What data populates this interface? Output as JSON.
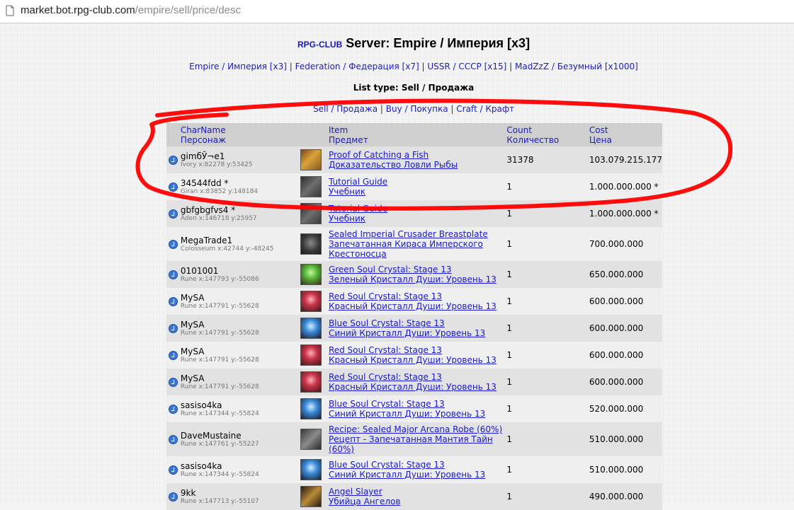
{
  "browser": {
    "url_host": "market.bot.rpg-club.com",
    "url_path": "/empire/sell/price/desc"
  },
  "header": {
    "brand": "RPG-CLUB",
    "title": "Server: Empire / Империя [x3]",
    "servers": [
      "Empire / Империя [x3]",
      "Federation / Федерация [x7]",
      "USSR / СССР [x15]",
      "MadZzZ / Безумный [x1000]"
    ],
    "separator": "|",
    "list_type": "List type: Sell / Продажа",
    "types": [
      "Sell / Продажа",
      "Buy / Покупка",
      "Craft / Крафт"
    ]
  },
  "table": {
    "columns": {
      "char": [
        "CharName",
        "Персонаж"
      ],
      "item": [
        "Item",
        "Предмет"
      ],
      "count": [
        "Count",
        "Количество"
      ],
      "cost": [
        "Cost",
        "Цена"
      ]
    },
    "rows": [
      {
        "char": "gimбЎ¬e1",
        "loc": "Ivory x:82278 y:53425",
        "icon": "fish-proof-icon",
        "item_en": "Proof of Catching a Fish",
        "item_ru": "Доказательство Ловли Рыбы",
        "count": "31378",
        "cost": "103.079.215.177"
      },
      {
        "char": "34544fdd *",
        "loc": "Giran x:83852 y:148184",
        "icon": "book-icon",
        "item_en": "Tutorial Guide",
        "item_ru": "Учебник",
        "count": "1",
        "cost": "1.000.000.000 *"
      },
      {
        "char": "gbfgbgfvs4 *",
        "loc": "Aden x:146718 y:25957",
        "icon": "book-icon",
        "item_en": "Tutorial Guide",
        "item_ru": "Учебник",
        "count": "1",
        "cost": "1.000.000.000 *"
      },
      {
        "char": "MegaTrade1",
        "loc": "Colosseum x:42744 y:-48245",
        "icon": "breastplate-icon",
        "item_en": "Sealed Imperial Crusader Breastplate",
        "item_ru": "Запечатанная Кираса Имперского Крестоносца",
        "count": "1",
        "cost": "700.000.000"
      },
      {
        "char": "0101001",
        "loc": "Rune x:147793 y:-55086",
        "icon": "green-crystal-icon",
        "item_en": "Green Soul Crystal: Stage 13",
        "item_ru": "Зеленый Кристалл Души: Уровень 13",
        "count": "1",
        "cost": "650.000.000"
      },
      {
        "char": "MySA",
        "loc": "Rune x:147791 y:-55628",
        "icon": "red-crystal-icon",
        "item_en": "Red Soul Crystal: Stage 13",
        "item_ru": "Красный Кристалл Души: Уровень 13",
        "count": "1",
        "cost": "600.000.000"
      },
      {
        "char": "MySA",
        "loc": "Rune x:147791 y:-55628",
        "icon": "blue-crystal-icon",
        "item_en": "Blue Soul Crystal: Stage 13",
        "item_ru": "Синий Кристалл Души: Уровень 13",
        "count": "1",
        "cost": "600.000.000"
      },
      {
        "char": "MySA",
        "loc": "Rune x:147791 y:-55628",
        "icon": "red-crystal-icon",
        "item_en": "Red Soul Crystal: Stage 13",
        "item_ru": "Красный Кристалл Души: Уровень 13",
        "count": "1",
        "cost": "600.000.000"
      },
      {
        "char": "MySA",
        "loc": "Rune x:147791 y:-55628",
        "icon": "red-crystal-icon",
        "item_en": "Red Soul Crystal: Stage 13",
        "item_ru": "Красный Кристалл Души: Уровень 13",
        "count": "1",
        "cost": "600.000.000"
      },
      {
        "char": "sasiso4ka",
        "loc": "Rune x:147344 y:-55824",
        "icon": "blue-crystal-icon",
        "item_en": "Blue Soul Crystal: Stage 13",
        "item_ru": "Синий Кристалл Души: Уровень 13",
        "count": "1",
        "cost": "520.000.000"
      },
      {
        "char": "DaveMustaine",
        "loc": "Rune x:147761 y:-55227",
        "icon": "recipe-icon",
        "item_en": "Recipe: Sealed Major Arcana Robe (60%)",
        "item_ru": "Рецепт - Запечатанная Мантия Тайн (60%)",
        "count": "1",
        "cost": "510.000.000"
      },
      {
        "char": "sasiso4ka",
        "loc": "Rune x:147344 y:-55824",
        "icon": "blue-crystal-icon",
        "item_en": "Blue Soul Crystal: Stage 13",
        "item_ru": "Синий Кристалл Души: Уровень 13",
        "count": "1",
        "cost": "510.000.000"
      },
      {
        "char": "9kk",
        "loc": "Rune x:147713 y:-55107",
        "icon": "sword-icon",
        "item_en": "Angel Slayer",
        "item_ru": "Убийца Ангелов",
        "count": "1",
        "cost": "490.000.000"
      }
    ]
  },
  "colors": {
    "link": "#1a1acc",
    "brand": "#1515c8",
    "header_bg": "#cfcfcf",
    "row_odd": "#e2e2e2",
    "row_even": "#efefef",
    "annotation": "#ff0000"
  },
  "annotation": {
    "type": "red-hand-drawn-circle",
    "highlights": "first two rows"
  }
}
